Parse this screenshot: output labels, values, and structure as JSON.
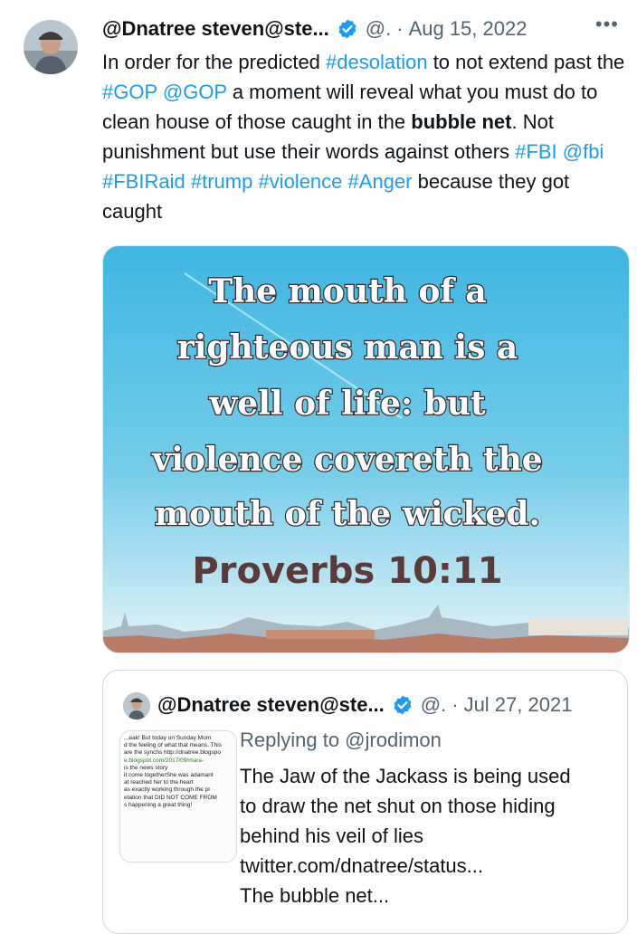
{
  "tweet": {
    "display_name": "@Dnatree steven@ste...",
    "handle": "@.",
    "separator": "·",
    "date": "Aug 15, 2022",
    "more_label": "•••",
    "text_segments": [
      {
        "t": "In order for the predicted ",
        "k": "plain"
      },
      {
        "t": "#desolation",
        "k": "tag"
      },
      {
        "t": " to not extend past the ",
        "k": "plain"
      },
      {
        "t": "#GOP",
        "k": "tag"
      },
      {
        "t": " ",
        "k": "plain"
      },
      {
        "t": "@GOP",
        "k": "tag"
      },
      {
        "t": " a moment will reveal what you must do to clean house of those caught in the ",
        "k": "plain"
      },
      {
        "t": "bubble net",
        "k": "bold"
      },
      {
        "t": ". Not punishment but use their words against others ",
        "k": "plain"
      },
      {
        "t": "#FBI",
        "k": "tag"
      },
      {
        "t": " ",
        "k": "plain"
      },
      {
        "t": "@fbi",
        "k": "tag"
      },
      {
        "t": " ",
        "k": "plain"
      },
      {
        "t": "#FBIRaid",
        "k": "tag"
      },
      {
        "t": " ",
        "k": "plain"
      },
      {
        "t": "#trump",
        "k": "tag"
      },
      {
        "t": " ",
        "k": "plain"
      },
      {
        "t": "#violence",
        "k": "tag"
      },
      {
        "t": " ",
        "k": "plain"
      },
      {
        "t": "#Anger",
        "k": "tag"
      },
      {
        "t": " because they got caught",
        "k": "plain"
      }
    ],
    "image": {
      "lines": [
        "The mouth of a",
        "righteous man is a",
        "well of life: but",
        "violence covereth the",
        "mouth of the wicked."
      ],
      "reference": "Proverbs 10:11"
    }
  },
  "quoted": {
    "display_name": "@Dnatree steven@ste...",
    "handle": "@.",
    "separator": "·",
    "date": "Jul 27, 2021",
    "replying_to": "Replying to @jrodimon",
    "text_lines": [
      "The Jaw of the Jackass is being used",
      "to draw the net shut on those hiding",
      "behind his veil of lies",
      "twitter.com/dnatree/status...",
      "The bubble net..."
    ],
    "thumbnail_lines": [
      "...eak! But today on Sunday Morn",
      "d the feeling of what that means. This",
      "are the synchs http://dnatree.blogspo",
      "e.blogspot.com/2017/09/mara-",
      "is the news story",
      "it come togetherShe was adamant",
      "at reached her to the heart",
      "as exactly working through the pr",
      "etation that DID NOT COME FROM",
      "s happening a great thing!"
    ]
  },
  "colors": {
    "link": "#1d9bf0",
    "verified": "#1d9bf0",
    "muted": "#536471",
    "quote_text": "#5c3a3a"
  }
}
